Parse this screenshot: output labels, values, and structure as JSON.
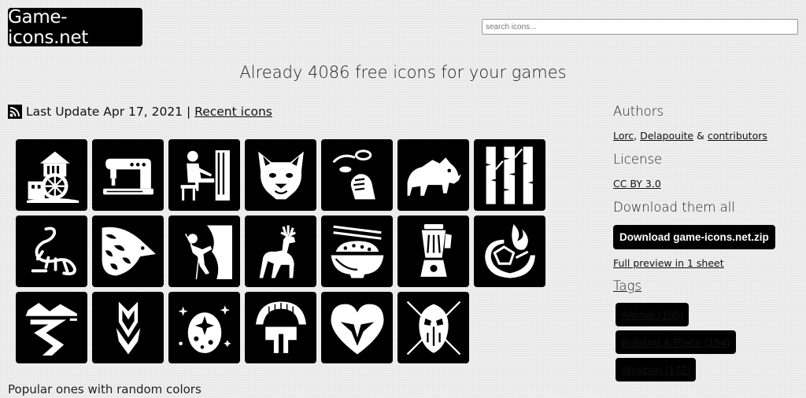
{
  "header": {
    "logo": "Game-icons.net",
    "search_placeholder": "search icons..."
  },
  "headline": "Already 4086 free icons for your games",
  "update": {
    "icon": "rss-icon",
    "text": "Last Update Apr 17, 2021 |",
    "recent_link": "Recent icons"
  },
  "icons": [
    {
      "name": "water-mill"
    },
    {
      "name": "sewing-machine"
    },
    {
      "name": "pianist"
    },
    {
      "name": "hyena-head"
    },
    {
      "name": "coin-flip"
    },
    {
      "name": "boar"
    },
    {
      "name": "birch-trees"
    },
    {
      "name": "dinosaur-bones"
    },
    {
      "name": "pangolin"
    },
    {
      "name": "mountain-climbing"
    },
    {
      "name": "deer"
    },
    {
      "name": "rice-bowl"
    },
    {
      "name": "blender"
    },
    {
      "name": "fire-gem"
    },
    {
      "name": "river"
    },
    {
      "name": "crystal-eruption"
    },
    {
      "name": "star-egg"
    },
    {
      "name": "centurion-helmet"
    },
    {
      "name": "heart-mask"
    },
    {
      "name": "tribal-shield"
    }
  ],
  "popular_heading": "Popular ones with random colors",
  "sidebar": {
    "authors_title": "Authors",
    "author1": "Lorc",
    "sep1": ",",
    "author2": "Delapouite",
    "amp": "&",
    "contributors": "contributors",
    "license_title": "License",
    "license": "CC BY 3.0",
    "download_title": "Download them all",
    "download_button": "Download game-icons.net.zip",
    "preview_link": "Full preview in 1 sheet",
    "tags_title": "Tags",
    "tags": [
      "Animal (185)",
      "Building & Place (184)",
      "Weapon (172)"
    ]
  }
}
